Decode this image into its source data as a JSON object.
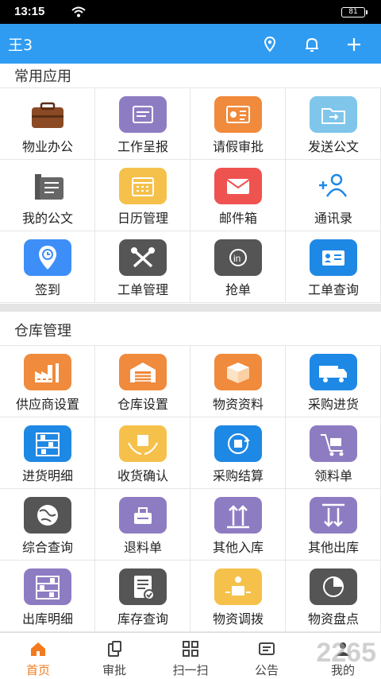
{
  "status": {
    "time": "13:15",
    "battery": "81"
  },
  "header": {
    "user": "王3"
  },
  "sections": {
    "common": {
      "title": "常用应用"
    },
    "warehouse": {
      "title": "仓库管理"
    }
  },
  "common_apps": [
    {
      "label": "物业办公",
      "icon": "briefcase-icon",
      "color": "#ffffff"
    },
    {
      "label": "工作呈报",
      "icon": "report-icon",
      "color": "#8e7cc3"
    },
    {
      "label": "请假审批",
      "icon": "leave-approval-icon",
      "color": "#f08a3c"
    },
    {
      "label": "发送公文",
      "icon": "folder-send-icon",
      "color": "#7fc6ea"
    },
    {
      "label": "我的公文",
      "icon": "documents-icon",
      "color": "#ffffff"
    },
    {
      "label": "日历管理",
      "icon": "calendar-icon",
      "color": "#f5c14b"
    },
    {
      "label": "邮件箱",
      "icon": "mail-icon",
      "color": "#ef5350"
    },
    {
      "label": "通讯录",
      "icon": "add-contact-icon",
      "color": "#ffffff"
    },
    {
      "label": "签到",
      "icon": "check-in-icon",
      "color": "#3e8ef7"
    },
    {
      "label": "工单管理",
      "icon": "tools-icon",
      "color": "#555555"
    },
    {
      "label": "抢单",
      "icon": "grab-order-icon",
      "color": "#555555"
    },
    {
      "label": "工单查询",
      "icon": "id-card-icon",
      "color": "#1e88e5"
    }
  ],
  "warehouse_apps": [
    {
      "label": "供应商设置",
      "icon": "factory-icon",
      "color": "#f08a3c"
    },
    {
      "label": "仓库设置",
      "icon": "warehouse-icon",
      "color": "#f08a3c"
    },
    {
      "label": "物资资料",
      "icon": "box-icon",
      "color": "#f08a3c"
    },
    {
      "label": "采购进货",
      "icon": "truck-icon",
      "color": "#1e88e5"
    },
    {
      "label": "进货明细",
      "icon": "shelf-icon",
      "color": "#1e88e5"
    },
    {
      "label": "收货确认",
      "icon": "hands-box-icon",
      "color": "#f5c14b"
    },
    {
      "label": "采购结算",
      "icon": "cycle-box-icon",
      "color": "#1e88e5"
    },
    {
      "label": "领料单",
      "icon": "cart-icon",
      "color": "#8e7cc3"
    },
    {
      "label": "综合查询",
      "icon": "globe-icon",
      "color": "#555555"
    },
    {
      "label": "退料单",
      "icon": "scale-icon",
      "color": "#8e7cc3"
    },
    {
      "label": "其他入库",
      "icon": "arrows-up-icon",
      "color": "#8e7cc3"
    },
    {
      "label": "其他出库",
      "icon": "arrows-down-icon",
      "color": "#8e7cc3"
    },
    {
      "label": "出库明细",
      "icon": "shelf-out-icon",
      "color": "#8e7cc3"
    },
    {
      "label": "库存查询",
      "icon": "checklist-icon",
      "color": "#555555"
    },
    {
      "label": "物资调拨",
      "icon": "transfer-icon",
      "color": "#f5c14b"
    },
    {
      "label": "物资盘点",
      "icon": "clock-chart-icon",
      "color": "#555555"
    }
  ],
  "tabs": [
    {
      "label": "首页",
      "icon": "home-icon",
      "active": true
    },
    {
      "label": "审批",
      "icon": "approval-icon",
      "active": false
    },
    {
      "label": "扫一扫",
      "icon": "scan-icon",
      "active": false
    },
    {
      "label": "公告",
      "icon": "notice-icon",
      "active": false
    },
    {
      "label": "我的",
      "icon": "user-icon",
      "active": false
    }
  ],
  "watermark": "2265",
  "colors": {
    "primary": "#2f9cf2",
    "active_tab": "#f37b1d"
  }
}
